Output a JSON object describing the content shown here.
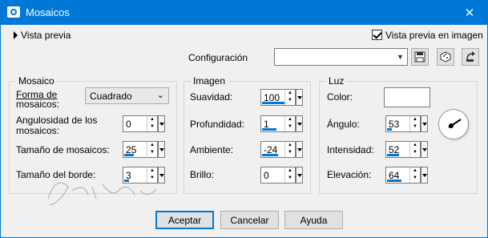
{
  "window": {
    "title": "Mosaicos",
    "close_glyph": "✕"
  },
  "toolbar": {
    "preview_toggle_label": "Vista previa",
    "preview_checkbox_label": "Vista previa en imagen",
    "preview_checked": true,
    "config_label": "Configuración",
    "config_value": "",
    "icons": [
      "save-icon",
      "randomize-icon",
      "reset-icon"
    ]
  },
  "mosaico": {
    "title": "Mosaico",
    "forma_label_line1": "Forma de",
    "forma_label_line2": "mosaicos:",
    "forma_value": "Cuadrado",
    "angulosidad_label_line1": "Angulosidad de los",
    "angulosidad_label_line2": "mosaicos:",
    "angulosidad_value": "0",
    "tamano_mosaicos_label": "Tamaño de mosaicos:",
    "tamano_mosaicos_value": "25",
    "tamano_borde_label": "Tamaño del borde:",
    "tamano_borde_value": "3"
  },
  "imagen": {
    "title": "Imagen",
    "suavidad_label": "Suavidad:",
    "suavidad_value": "100",
    "profundidad_label": "Profundidad:",
    "profundidad_value": "1",
    "ambiente_label": "Ambiente:",
    "ambiente_value": "-24",
    "brillo_label": "Brillo:",
    "brillo_value": "0"
  },
  "luz": {
    "title": "Luz",
    "color_label": "Color:",
    "color_value": "#ffffff",
    "angulo_label": "Ángulo:",
    "angulo_value": "53",
    "intensidad_label": "Intensidad:",
    "intensidad_value": "52",
    "elevacion_label": "Elevación:",
    "elevacion_value": "64"
  },
  "buttons": {
    "accept": "Aceptar",
    "cancel": "Cancelar",
    "help": "Ayuda"
  },
  "watermark": "Sylviane",
  "colors": {
    "title_bar": "#0078d7",
    "accent": "#0078d7",
    "background": "#f0f0f0"
  }
}
